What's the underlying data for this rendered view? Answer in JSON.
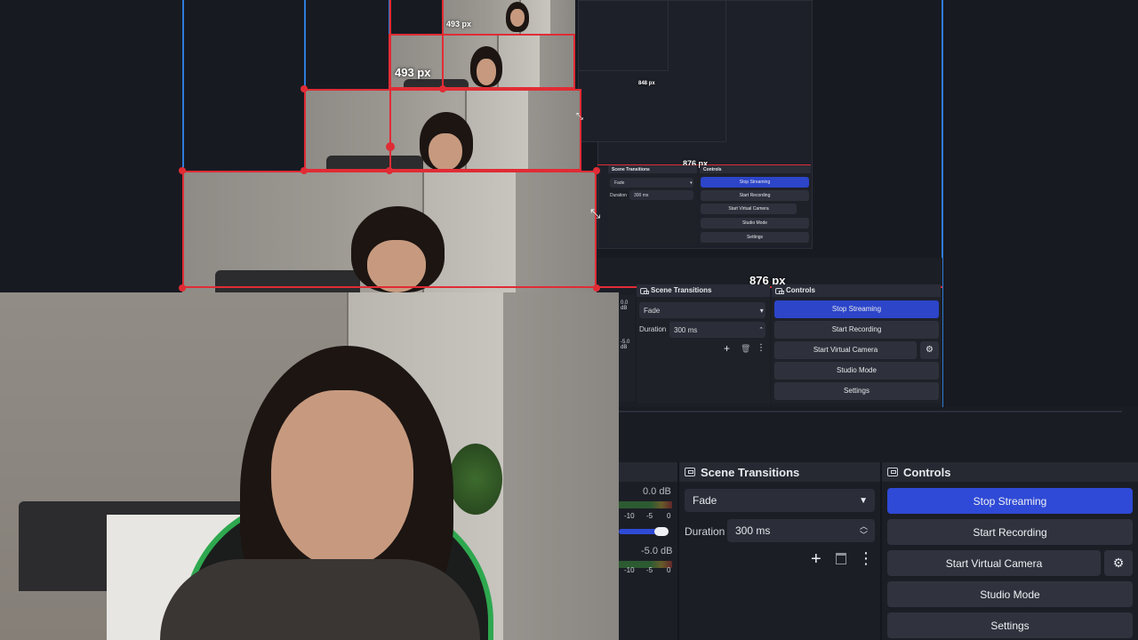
{
  "overlay": {
    "measure_top": "493 px",
    "measure_mid": "493 px",
    "measure_large": "876 px",
    "measure_tiny": "876 px",
    "measure_xl": "876 px",
    "measure_small_top": "848 px"
  },
  "main": {
    "scene_transitions": {
      "title": "Scene Transitions",
      "transition": "Fade",
      "duration_label": "Duration",
      "duration_value": "300 ms"
    },
    "controls": {
      "title": "Controls",
      "stop_streaming": "Stop Streaming",
      "start_recording": "Start Recording",
      "start_virtual_camera": "Start Virtual Camera",
      "studio_mode": "Studio Mode",
      "settings": "Settings"
    },
    "audio": {
      "level_top": "0.0 dB",
      "level_bottom": "-5.0 dB",
      "ticks": [
        "-10",
        "-5",
        "0"
      ]
    }
  },
  "mini1": {
    "scene_transitions": "Scene Transitions",
    "controls": "Controls",
    "transition": "Fade",
    "duration_label": "Duration",
    "duration_value": "300 ms",
    "stop_streaming": "Stop Streaming",
    "start_recording": "Start Recording",
    "start_virtual_camera": "Start Virtual Camera",
    "studio_mode": "Studio Mode",
    "settings": "Settings",
    "db_top": "0.0 dB",
    "db_bottom": "-5.0 dB"
  },
  "mini2": {
    "scene_transitions": "Scene Transitions",
    "controls": "Controls",
    "transition": "Fade",
    "duration_label": "Duration",
    "duration_value": "300 ms",
    "stop_streaming": "Stop Streaming",
    "start_recording": "Start Recording",
    "start_virtual_camera": "Start Virtual Camera",
    "studio_mode": "Studio Mode",
    "settings": "Settings"
  },
  "colors": {
    "accent": "#2f4ad6",
    "selection": "#e02c35",
    "guide": "#2e7bd9"
  },
  "icons": [
    "plus-icon",
    "trash-icon",
    "more-vertical-icon",
    "gear-icon",
    "chevron-down-icon",
    "chevron-up-icon",
    "dock-icon",
    "resize-cursor-icon"
  ]
}
